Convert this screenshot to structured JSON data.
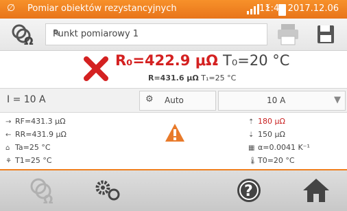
{
  "status_bar": {
    "title": "Pomiar obiektów rezystancyjnych",
    "time": "11:42 2017.12.06"
  },
  "toolbar": {
    "point_name": "Punkt pomiarowy 1"
  },
  "result": {
    "r0": "R₀=422.9 μΩ",
    "t0": "T₀=20 °C",
    "r_label": "R=431.6 μΩ",
    "t1": "T₁=25 °C"
  },
  "settings": {
    "current": "I = 10 A",
    "mode": "Auto",
    "range": "10 A"
  },
  "details": {
    "rf": "RF=431.3 μΩ",
    "rr": "RR=431.9 μΩ",
    "ta": "Ta=25 °C",
    "t1": "T1=25 °C",
    "limit_max": "180 μΩ",
    "limit_min": "150 μΩ",
    "alpha": "α=0.0041 K⁻¹",
    "t0": "T0=20 °C"
  },
  "colors": {
    "status_bar": "#f07f1e",
    "fail": "#d42121",
    "warning": "#e87a2a"
  }
}
